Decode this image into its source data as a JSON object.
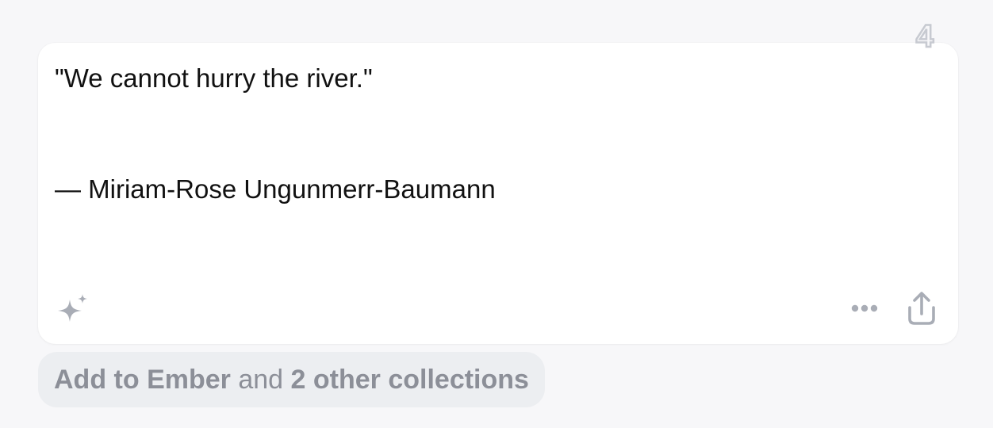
{
  "card": {
    "badge_count": "4",
    "quote": "\"We cannot hurry the river.\"",
    "author": "— Miriam-Rose Ungunmerr-Baumann"
  },
  "actions": {
    "sparkle_icon": "sparkle-icon",
    "more_icon": "more-horizontal-icon",
    "share_icon": "share-icon"
  },
  "collections": {
    "add_label": "Add to Ember",
    "connector": " and ",
    "others_label": "2 other collections"
  },
  "colors": {
    "background": "#f7f7f9",
    "card": "#ffffff",
    "text": "#111111",
    "icon": "#a9adb6",
    "pill": "#eceef1",
    "pill_text": "#8c8f98"
  }
}
